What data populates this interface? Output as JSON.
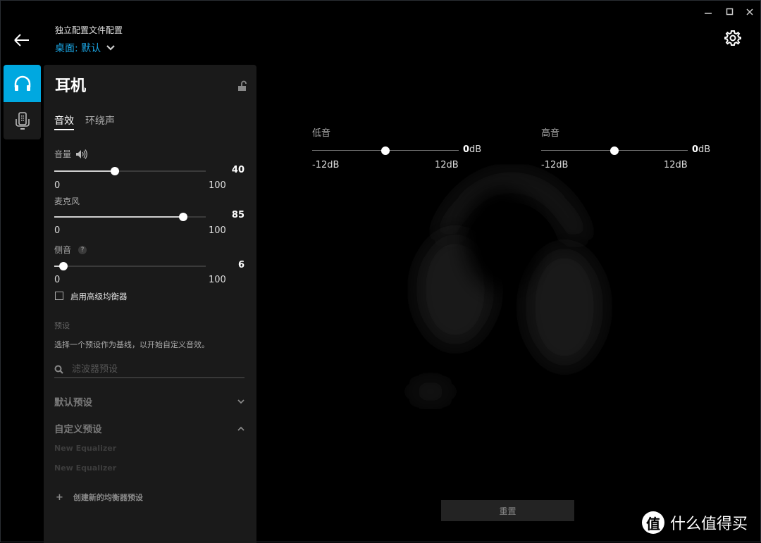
{
  "window_controls": {
    "minimize": "minimize-icon",
    "maximize": "maximize-icon",
    "close": "close-icon"
  },
  "header": {
    "back_icon": "arrow-left-icon",
    "profile_label": "独立配置文件配置",
    "profile_value": "桌面: 默认",
    "settings_icon": "gear-icon"
  },
  "nav": {
    "items": [
      {
        "icon": "headset-icon",
        "active": true
      },
      {
        "icon": "device-remote-icon",
        "active": false
      }
    ]
  },
  "panel": {
    "title": "耳机",
    "lock_icon": "unlock-icon",
    "tabs": [
      {
        "label": "音效",
        "active": true
      },
      {
        "label": "环绕声",
        "active": false
      }
    ],
    "sliders": [
      {
        "label": "音量",
        "icon": "speaker-icon",
        "value": 40,
        "min": "0",
        "max": "100",
        "value_text": "40"
      },
      {
        "label": "麦克风",
        "value": 85,
        "min": "0",
        "max": "100",
        "value_text": "85"
      },
      {
        "label": "侧音",
        "help_icon": "?",
        "value": 6,
        "min": "0",
        "max": "100",
        "value_text": "6"
      }
    ],
    "advanced_eq_label": "启用高级均衡器",
    "advanced_eq_checked": false,
    "presets_heading": "预设",
    "presets_description": "选择一个预设作为基线，以开始自定义音效。",
    "search_placeholder": "滤波器预设",
    "search_value": "",
    "default_presets_label": "默认预设",
    "custom_presets_label": "自定义预设",
    "custom_presets": [
      "New Equalizer",
      "New Equalizer"
    ],
    "create_label": "创建新的均衡器预设",
    "create_icon": "+"
  },
  "eq": {
    "bass": {
      "label": "低音",
      "value": 0,
      "min": -12,
      "max": 12,
      "value_num": "0",
      "unit": "dB",
      "min_text": "-12dB",
      "max_text": "12dB"
    },
    "treble": {
      "label": "高音",
      "value": 0,
      "min": -12,
      "max": 12,
      "value_num": "0",
      "unit": "dB",
      "min_text": "-12dB",
      "max_text": "12dB"
    },
    "reset_label": "重置"
  },
  "watermark": {
    "badge": "值",
    "text": "什么值得买"
  }
}
